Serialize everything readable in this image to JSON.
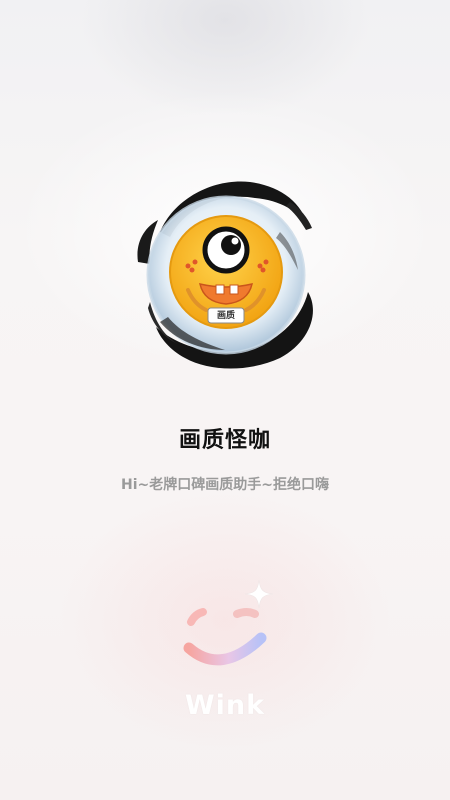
{
  "app": {
    "name": "画质怪咖",
    "tagline": "Hi~老牌口碑画质助手~拒绝口嗨",
    "logo_badge": "画质"
  },
  "brand": {
    "wordmark": "Wink"
  },
  "colors": {
    "mascot_yellow": "#f6b21c",
    "ink": "#141414",
    "tagline_gray": "#9a9a9a",
    "brand_pink": "#f4a0a0",
    "brand_blue": "#b8c3f8"
  },
  "icons": [
    "mascot-logo-icon",
    "wink-logo-icon",
    "sparkle-icon"
  ]
}
